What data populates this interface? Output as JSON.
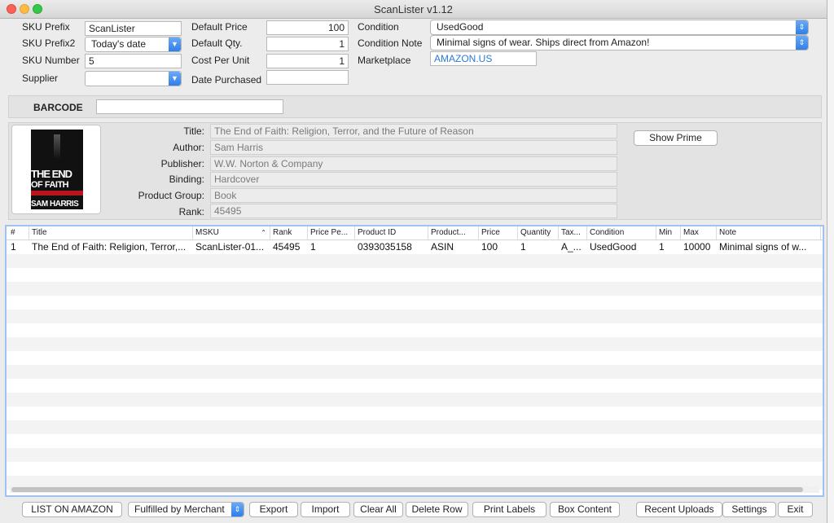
{
  "window": {
    "title": "ScanLister v1.12"
  },
  "form": {
    "sku_prefix_label": "SKU Prefix",
    "sku_prefix_value": "ScanLister",
    "sku_prefix2_label": "SKU Prefix2",
    "sku_prefix2_value": "Today's date",
    "sku_number_label": "SKU Number",
    "sku_number_value": "5",
    "supplier_label": "Supplier",
    "supplier_value": "",
    "default_price_label": "Default Price",
    "default_price_value": "100",
    "default_qty_label": "Default Qty.",
    "default_qty_value": "1",
    "cost_per_unit_label": "Cost Per Unit",
    "cost_per_unit_value": "1",
    "date_purchased_label": "Date Purchased",
    "date_purchased_value": "",
    "condition_label": "Condition",
    "condition_value": "UsedGood",
    "condition_note_label": "Condition Note",
    "condition_note_value": "Minimal signs of wear. Ships direct from Amazon!",
    "marketplace_label": "Marketplace",
    "marketplace_value": "AMAZON.US"
  },
  "barcode": {
    "label": "BARCODE",
    "value": ""
  },
  "book": {
    "cover_title_1": "THE END",
    "cover_title_2": "OF FAITH",
    "cover_author": "SAM HARRIS",
    "title_label": "Title:",
    "title": "The End of Faith: Religion, Terror, and the Future of Reason",
    "author_label": "Author:",
    "author": "Sam Harris",
    "publisher_label": "Publisher:",
    "publisher": "W.W. Norton & Company",
    "binding_label": "Binding:",
    "binding": "Hardcover",
    "product_group_label": "Product Group:",
    "product_group": "Book",
    "rank_label": "Rank:",
    "rank": "45495",
    "show_prime_label": "Show Prime"
  },
  "table": {
    "columns": [
      "#",
      "Title",
      "MSKU",
      "Rank",
      "Price Pe...",
      "Product ID",
      "Product...",
      "Price",
      "Quantity",
      "Tax...",
      "Condition",
      "Min",
      "Max",
      "Note"
    ],
    "rows": [
      [
        "1",
        "The End of Faith: Religion, Terror,...",
        "ScanLister-01...",
        "45495",
        "1",
        "0393035158",
        "ASIN",
        "100",
        "1",
        "A_...",
        "UsedGood",
        "1",
        "10000",
        "Minimal signs of w..."
      ]
    ]
  },
  "footer": {
    "list_on_amazon": "LIST ON AMAZON",
    "fulfillment_value": "Fulfilled by Merchant",
    "export": "Export",
    "import": "Import",
    "clear_all": "Clear All",
    "delete_row": "Delete Row",
    "print_labels": "Print Labels",
    "box_content": "Box Content",
    "recent_uploads": "Recent Uploads",
    "settings": "Settings",
    "exit": "Exit"
  },
  "colors": {
    "accent": "#2f7fe9",
    "link_value": "#2c7bd6",
    "table_focus_ring": "#9fc3ee"
  }
}
